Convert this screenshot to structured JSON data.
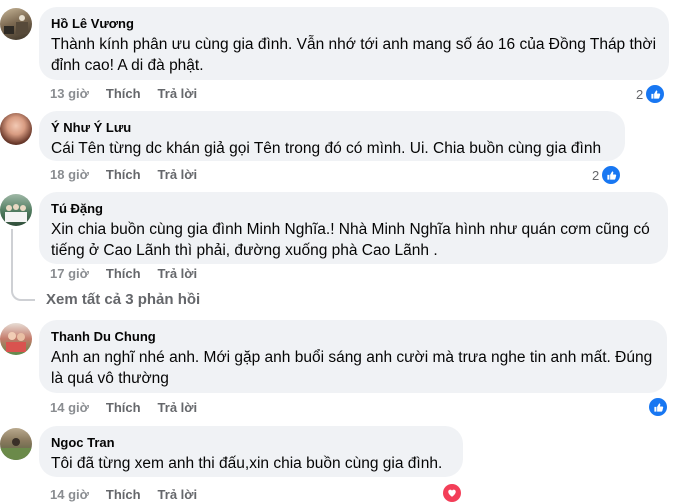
{
  "comments": [
    {
      "author": "Hồ Lê Vương",
      "text": "Thành kính phân ưu cùng gia đình. Vẫn nhớ tới anh mang số áo 16 của Đồng Tháp thời đỉnh cao! A di đà phật.",
      "time": "13 giờ",
      "like": "Thích",
      "reply": "Trả lời",
      "reaction_count": "2"
    },
    {
      "author": "Ý Như Ý Lưu",
      "text": "Cái Tên từng dc khán giả gọi Tên trong đó có mình. Ui. Chia buồn cùng gia đình",
      "time": "18 giờ",
      "like": "Thích",
      "reply": "Trả lời",
      "reaction_count": "2"
    },
    {
      "author": "Tú Đặng",
      "text": "Xin chia buồn cùng gia đình Minh Nghĩa.! Nhà Minh Nghĩa hình như quán cơm cũng có tiếng ở Cao Lãnh thì phải, đường xuống phà Cao Lãnh .",
      "time": "17 giờ",
      "like": "Thích",
      "reply": "Trả lời",
      "reaction_count": ""
    },
    {
      "author": "Thanh Du Chung",
      "text": "Anh an nghĩ nhé anh. Mới gặp anh buổi sáng anh cười mà trưa nghe tin anh mất. Đúng là quá vô thường",
      "time": "14 giờ",
      "like": "Thích",
      "reply": "Trả lời",
      "reaction_count": ""
    },
    {
      "author": "Ngoc Tran",
      "text": "Tôi đã từng xem anh thi đấu,xin chia buồn cùng gia đình.",
      "time": "14 giờ",
      "like": "Thích",
      "reply": "Trả lời",
      "reaction_count": ""
    }
  ],
  "view_replies": "Xem tất cả 3 phản hồi",
  "colors": {
    "like_blue": "#1877f2",
    "bubble_bg": "#f0f2f5",
    "meta_gray": "#65676b",
    "heart_red": "#f33e58"
  }
}
